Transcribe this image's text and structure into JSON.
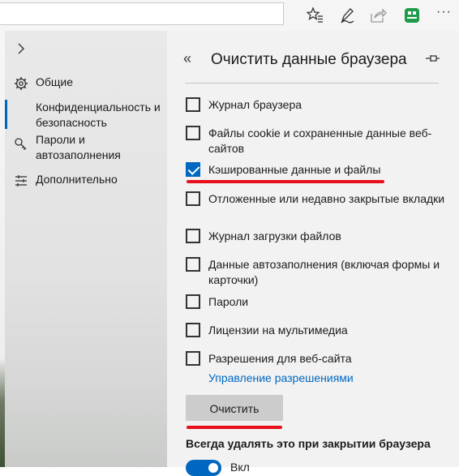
{
  "toolbar": {
    "icons": [
      "favorites-star-icon",
      "pen-icon",
      "share-icon",
      "extension-icon",
      "more-icon"
    ],
    "more_label": "···"
  },
  "nav": {
    "items": [
      {
        "label": "Общие",
        "icon": "gear-icon"
      },
      {
        "label": "Конфиденциальность и безопасность",
        "icon": "lock-icon",
        "active": true
      },
      {
        "label": "Пароли и автозаполнения",
        "icon": "key-icon"
      },
      {
        "label": "Дополнительно",
        "icon": "sliders-icon"
      }
    ]
  },
  "panel": {
    "back_label": "«",
    "title": "Очистить данные браузера",
    "items": [
      {
        "label": "Журнал браузера",
        "checked": false
      },
      {
        "label": "Файлы cookie и сохраненные данные веб-сайтов",
        "checked": false
      },
      {
        "label": "Кэшированные данные и файлы",
        "checked": true
      },
      {
        "label": "Отложенные или недавно закрытые вкладки",
        "checked": false
      },
      {
        "label": "Журнал загрузки файлов",
        "checked": false
      },
      {
        "label": "Данные автозаполнения (включая формы и карточки)",
        "checked": false
      },
      {
        "label": "Пароли",
        "checked": false
      },
      {
        "label": "Лицензии на мультимедиа",
        "checked": false
      },
      {
        "label": "Разрешения для веб-сайта",
        "checked": false
      }
    ],
    "manage_permissions_link": "Управление разрешениями",
    "clear_button": "Очистить",
    "always_clear_label": "Всегда удалять это при закрытии браузера",
    "toggle_label": "Вкл"
  },
  "colors": {
    "accent": "#0067c0",
    "highlight": "#e8101b"
  }
}
